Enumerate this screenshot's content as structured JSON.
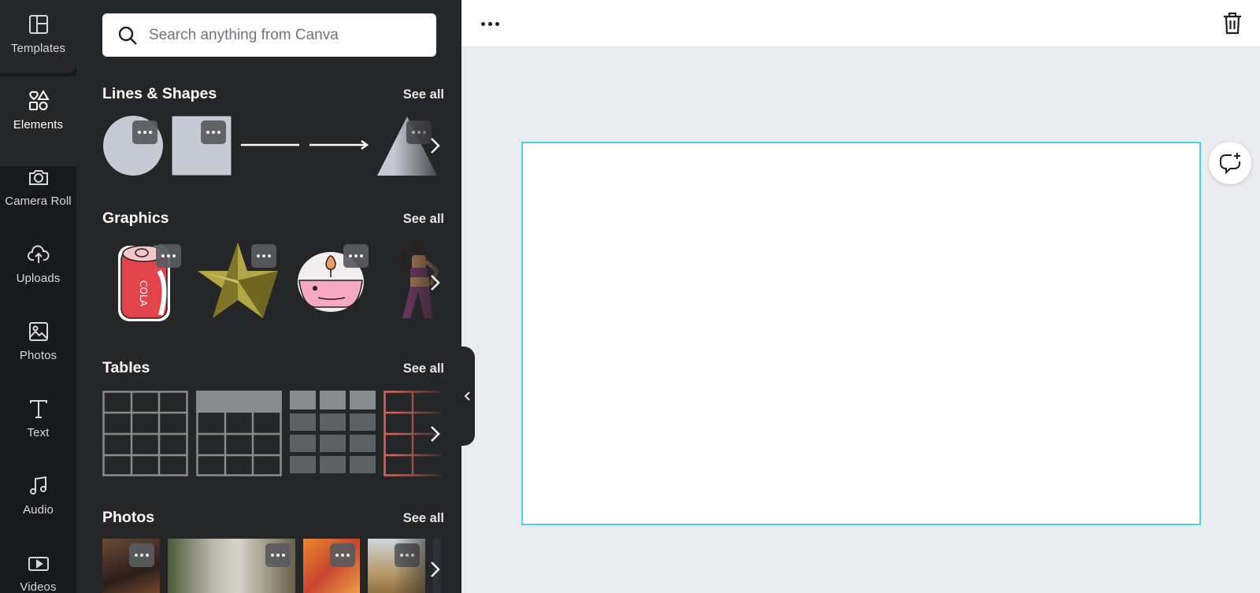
{
  "rail": {
    "items": [
      {
        "label": "Templates",
        "icon": "templates-icon"
      },
      {
        "label": "Elements",
        "icon": "elements-icon"
      },
      {
        "label": "Camera Roll",
        "icon": "camera-icon"
      },
      {
        "label": "Uploads",
        "icon": "upload-cloud-icon"
      },
      {
        "label": "Photos",
        "icon": "image-icon"
      },
      {
        "label": "Text",
        "icon": "text-icon"
      },
      {
        "label": "Audio",
        "icon": "music-note-icon"
      },
      {
        "label": "Videos",
        "icon": "video-icon"
      }
    ],
    "active": "Elements"
  },
  "search": {
    "placeholder": "Search anything from Canva"
  },
  "sections": {
    "lines_shapes": {
      "title": "Lines & Shapes",
      "see_all": "See all"
    },
    "graphics": {
      "title": "Graphics",
      "see_all": "See all"
    },
    "tables": {
      "title": "Tables",
      "see_all": "See all"
    },
    "photos": {
      "title": "Photos",
      "see_all": "See all"
    }
  },
  "colors": {
    "accent_selection": "#4ed1dc",
    "panel_bg": "#252627",
    "rail_bg": "#18191b",
    "canvas_bg": "#ebecf0",
    "shape_fill": "#c5cad3"
  }
}
